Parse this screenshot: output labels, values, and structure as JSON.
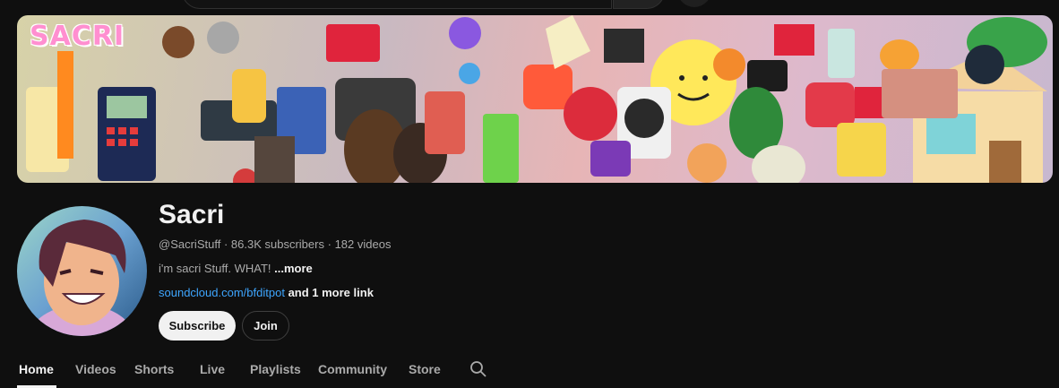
{
  "banner": {
    "logo_text": "SACRI"
  },
  "channel": {
    "name": "Sacri",
    "handle": "@SacriStuff",
    "subscribers": "86.3K subscribers",
    "videos": "182 videos",
    "description": "i'm sacri Stuff. WHAT!",
    "more_label": "...more",
    "link": "soundcloud.com/bfditpot",
    "more_links": "and 1 more link",
    "separator": "·"
  },
  "buttons": {
    "subscribe": "Subscribe",
    "join": "Join"
  },
  "tabs": [
    {
      "label": "Home",
      "active": true
    },
    {
      "label": "Videos"
    },
    {
      "label": "Shorts"
    },
    {
      "label": "Live"
    },
    {
      "label": "Playlists"
    },
    {
      "label": "Community"
    },
    {
      "label": "Store"
    }
  ],
  "icons": {
    "tab_search": "search-icon"
  },
  "colors": {
    "background": "#0f0f0f",
    "text_primary": "#f1f1f1",
    "text_secondary": "#aaaaaa",
    "link": "#3ea6ff",
    "subscribe_bg": "#f1f1f1"
  }
}
